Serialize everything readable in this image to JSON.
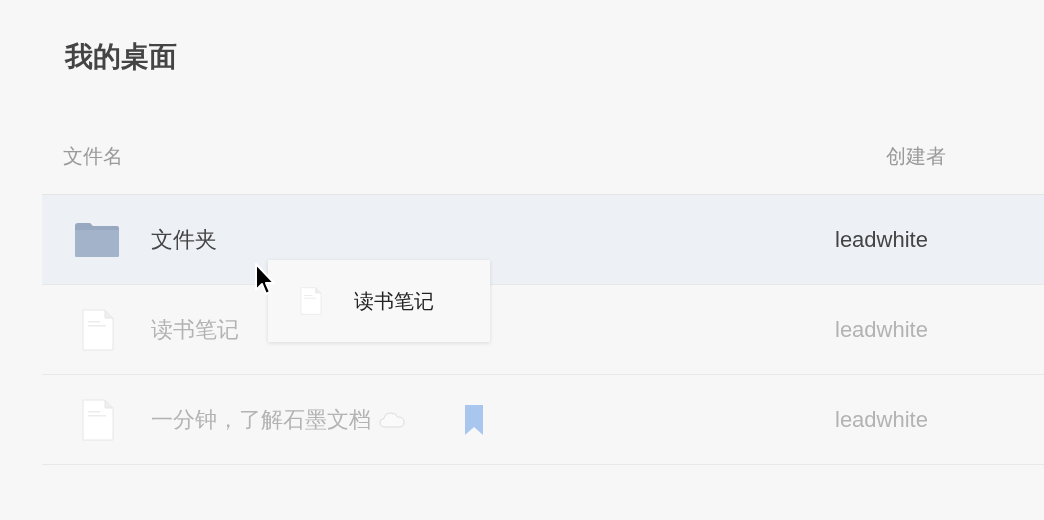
{
  "title": "我的桌面",
  "columns": [
    "文件名",
    "创建者"
  ],
  "rows": [
    {
      "kind": "folder",
      "name": "文件夹",
      "creator": "leadwhite",
      "selected": true,
      "cloud": false,
      "bookmarked": false
    },
    {
      "kind": "document",
      "name": "读书笔记",
      "creator": "leadwhite",
      "selected": false,
      "cloud": false,
      "bookmarked": false
    },
    {
      "kind": "document",
      "name": "一分钟，了解石墨文档",
      "creator": "leadwhite",
      "selected": false,
      "cloud": true,
      "bookmarked": true
    }
  ],
  "drag_preview": {
    "kind": "document",
    "label": "读书笔记"
  }
}
